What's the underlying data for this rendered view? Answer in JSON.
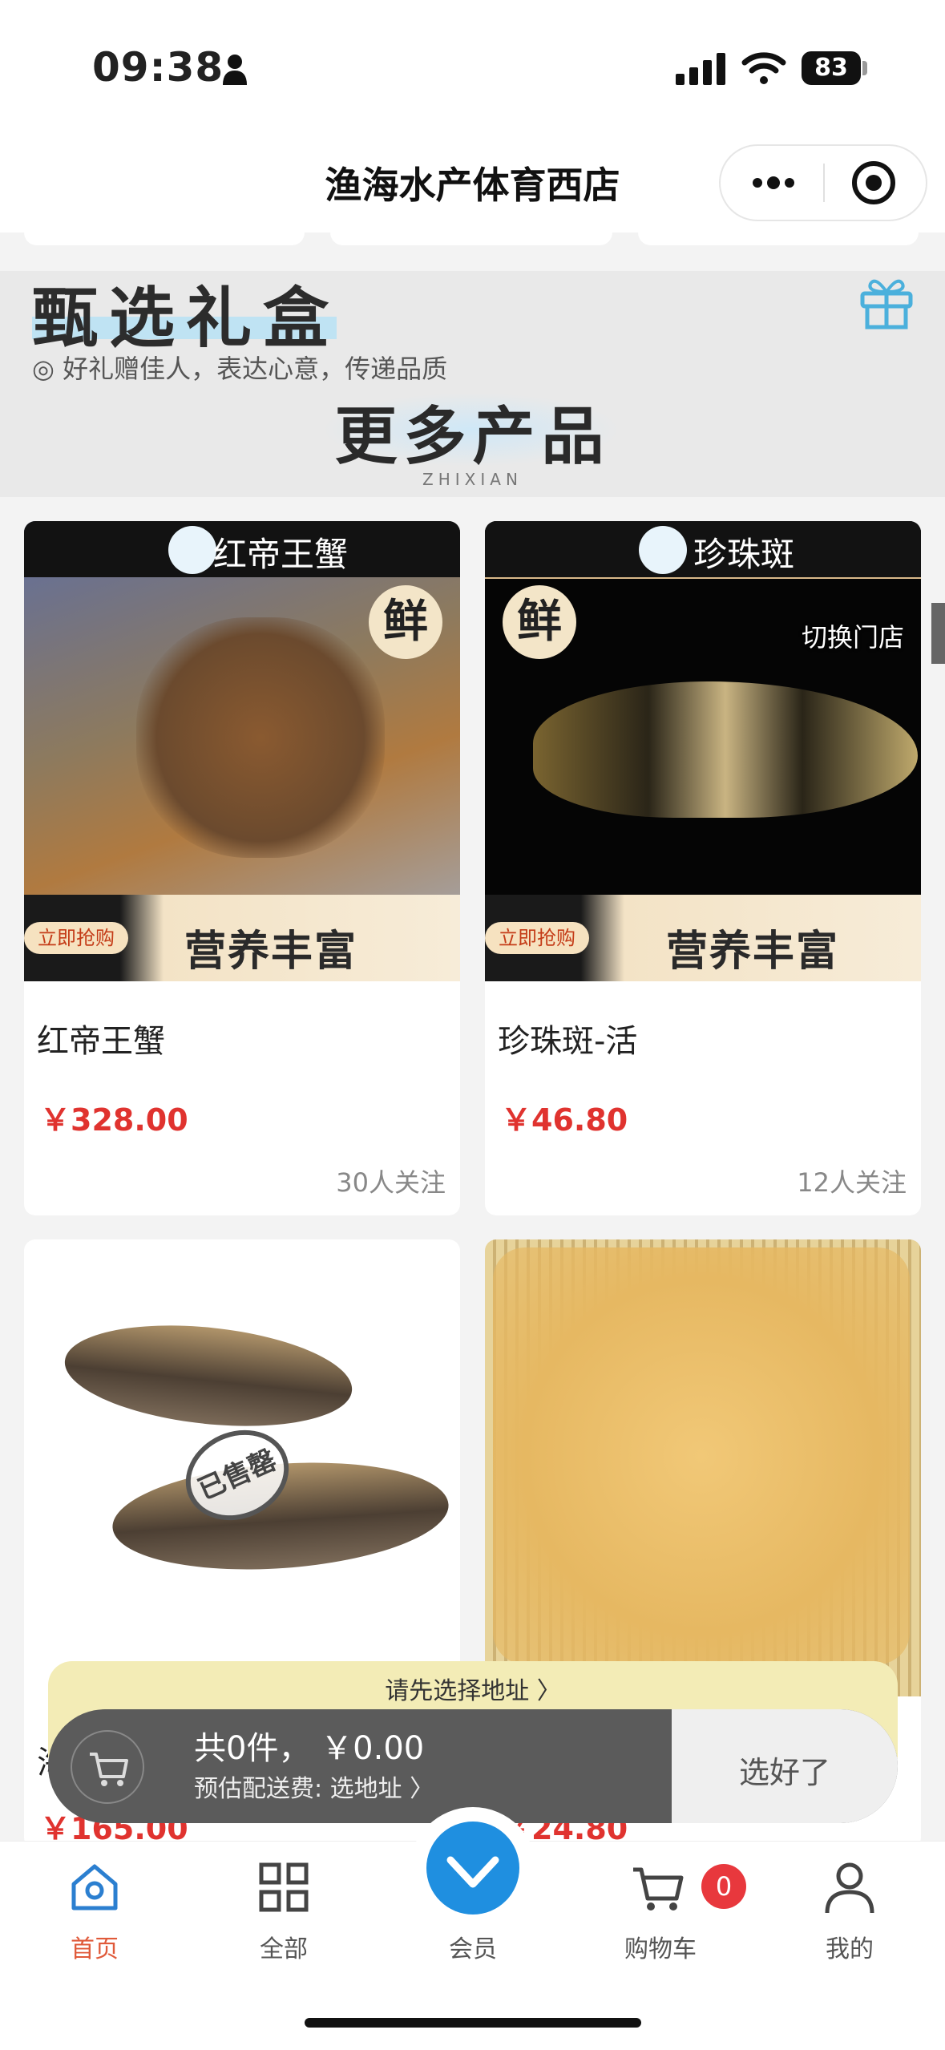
{
  "status": {
    "time": "09:38",
    "battery": "83"
  },
  "nav": {
    "title": "渔海水产体育西店"
  },
  "banner": {
    "title": "甄选礼盒",
    "subtitle": "◎ 好礼赠佳人，表达心意，传递品质",
    "more": "更多产品",
    "more_sub": "ZHIXIAN"
  },
  "side": {
    "switch_store": "切换门店"
  },
  "products": [
    {
      "name": "红帝王蟹",
      "price": "￥328.00",
      "follow": "30人关注",
      "img_header": "红帝王蟹",
      "fresh": "鲜",
      "buy_tag": "立即抢购",
      "slogan": "营养丰富"
    },
    {
      "name": "珍珠斑-活",
      "price": "￥46.80",
      "follow": "12人关注",
      "img_header": "珍珠斑",
      "fresh": "鲜",
      "buy_tag": "立即抢购",
      "slogan": "营养丰富"
    },
    {
      "name": "海",
      "price": "￥165.00",
      "sold_out": "已售罄"
    },
    {
      "name": "",
      "price": "￥24.80"
    }
  ],
  "cart": {
    "address_prompt": "请先选择地址 〉",
    "summary": "共0件，  ￥0.00",
    "fee": "预估配送费: 选地址 〉",
    "confirm": "选好了"
  },
  "tabbar": {
    "items": [
      {
        "label": "首页",
        "icon": "home-icon",
        "active": true
      },
      {
        "label": "全部",
        "icon": "grid-icon"
      },
      {
        "label": "会员",
        "icon": "vip-diamond-icon"
      },
      {
        "label": "购物车",
        "icon": "cart-icon",
        "badge": "0"
      },
      {
        "label": "我的",
        "icon": "person-icon"
      }
    ]
  },
  "colors": {
    "accent": "#e0332f",
    "active_tab": "#e05a3a",
    "vip": "#1f8fe0"
  }
}
